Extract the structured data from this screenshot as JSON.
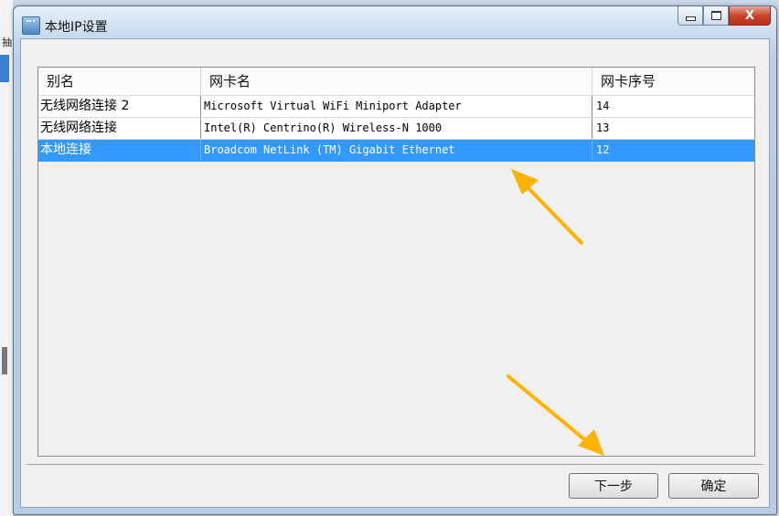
{
  "window": {
    "title": "本地IP设置",
    "icon": "network-settings-icon",
    "controls": {
      "minimize": "minimize-icon",
      "maximize": "maximize-icon",
      "close_label": "X"
    }
  },
  "table": {
    "columns": [
      "别名",
      "网卡名",
      "网卡序号"
    ],
    "rows": [
      {
        "alias": "无线网络连接 2",
        "adapter": "Microsoft Virtual WiFi Miniport Adapter",
        "index": "14",
        "selected": false
      },
      {
        "alias": "无线网络连接",
        "adapter": "Intel(R) Centrino(R) Wireless-N 1000",
        "index": "13",
        "selected": false
      },
      {
        "alias": "本地连接",
        "adapter": "Broadcom NetLink (TM) Gigabit Ethernet",
        "index": "12",
        "selected": true
      }
    ]
  },
  "buttons": {
    "next_label": "下一步",
    "ok_label": "确定"
  },
  "background": {
    "side_char": "抽"
  },
  "colors": {
    "selection": "#3399ff",
    "arrow": "#ffb300",
    "close_button": "#c9452b"
  }
}
